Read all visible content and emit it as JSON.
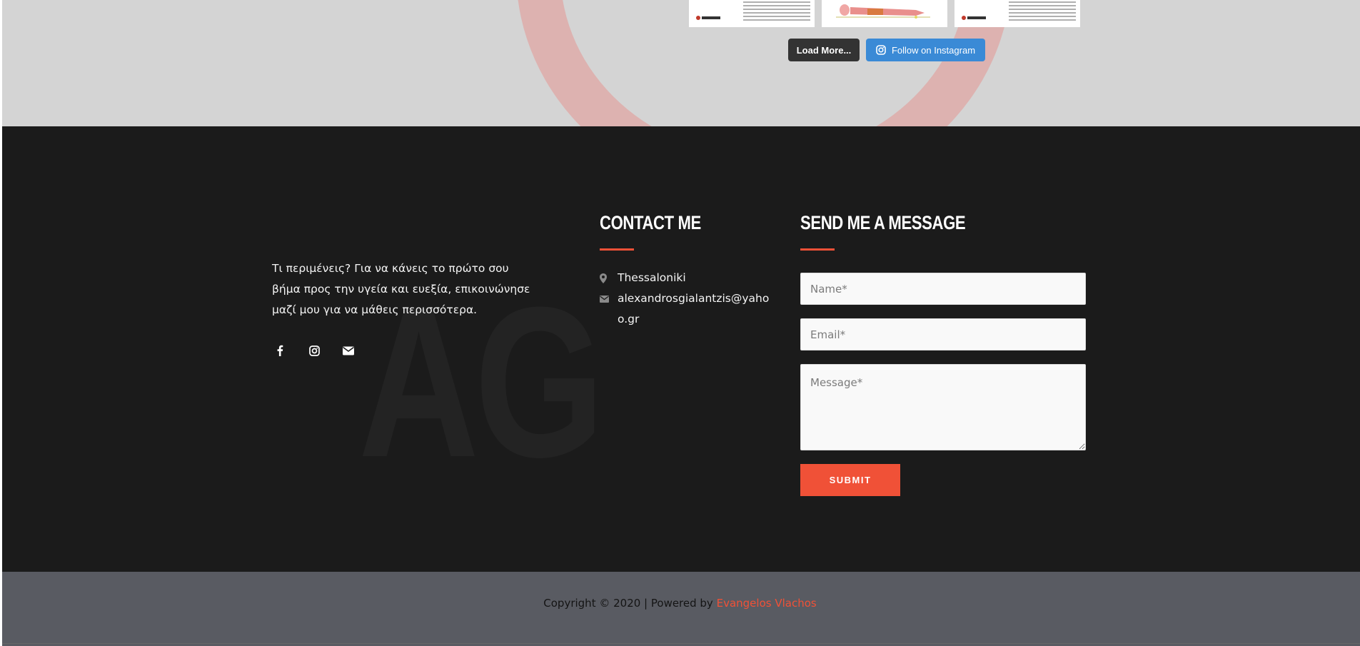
{
  "instagram": {
    "load_more_label": "Load More...",
    "follow_label": "Follow on Instagram",
    "thumbnails": [
      {
        "alt": "instagram-post-1"
      },
      {
        "alt": "instagram-post-2"
      },
      {
        "alt": "instagram-post-3"
      }
    ]
  },
  "about": {
    "text": "Τι περιμένεις? Για να κάνεις το πρώτο σου βήμα προς την υγεία και ευεξία, επικοινώνησε μαζί μου για να μάθεις περισσότερα.",
    "watermark": "AG",
    "socials": [
      {
        "icon": "facebook-icon"
      },
      {
        "icon": "instagram-icon"
      },
      {
        "icon": "envelope-icon"
      }
    ]
  },
  "contact": {
    "title": "Contact Me",
    "location": "Thessaloniki",
    "email": "alexandrosgialantzis@yahoo.gr"
  },
  "message_form": {
    "title": "Send Me A Message",
    "name_placeholder": "Name*",
    "email_placeholder": "Email*",
    "message_placeholder": "Message*",
    "submit_label": "SUBMIT"
  },
  "copyright": {
    "text": "Copyright © 2020 | Powered by",
    "author": "Evangelos Vlachos"
  },
  "colors": {
    "accent": "#f05137",
    "footer_bg": "#1b1b1b",
    "copyright_bg": "#595b62",
    "instagram_blue": "#3a8ad6"
  }
}
